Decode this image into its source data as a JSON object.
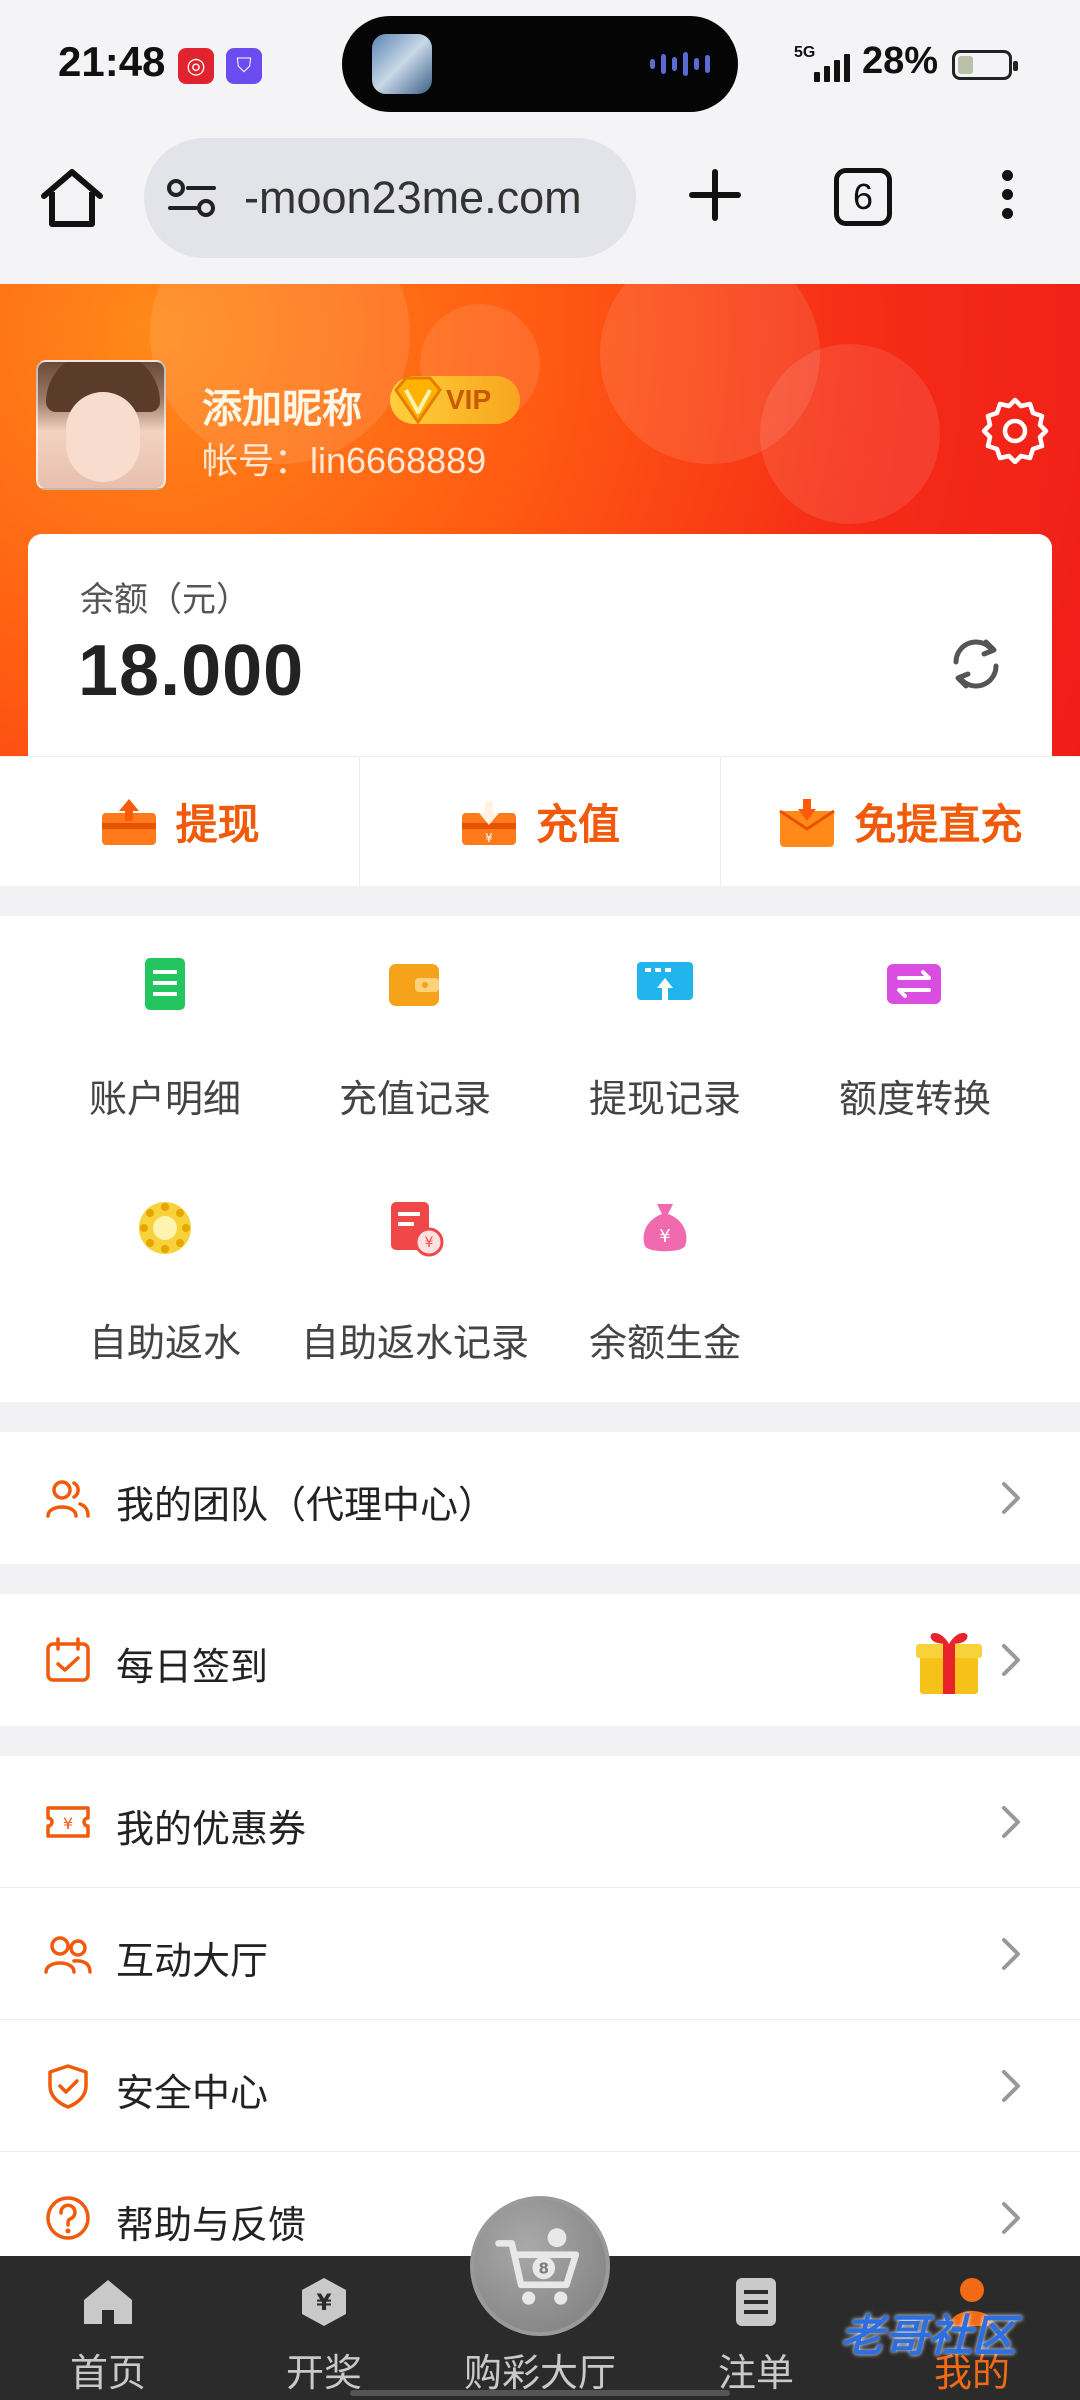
{
  "status_bar": {
    "time": "21:48",
    "network": "5G",
    "battery": "28%"
  },
  "browser": {
    "url": "-moon23me.com",
    "tab_count": "6"
  },
  "profile": {
    "nickname": "添加昵称",
    "vip_label": "VIP",
    "account": "帐号：lin6668889"
  },
  "balance": {
    "label": "余额（元）",
    "value": "18.000"
  },
  "actions": [
    {
      "label": "提现"
    },
    {
      "label": "充值"
    },
    {
      "label": "免提直充"
    }
  ],
  "grid": [
    {
      "label": "账户明细",
      "icon": "ledger-icon",
      "color": "#22c55e"
    },
    {
      "label": "充值记录",
      "icon": "wallet-icon",
      "color": "#f59e0b"
    },
    {
      "label": "提现记录",
      "icon": "withdraw-card-icon",
      "color": "#22a7e8"
    },
    {
      "label": "额度转换",
      "icon": "transfer-icon",
      "color": "#d946ef"
    },
    {
      "label": "自助返水",
      "icon": "coin-icon",
      "color": "#f5c518"
    },
    {
      "label": "自助返水记录",
      "icon": "rebate-record-icon",
      "color": "#ef4444"
    },
    {
      "label": "余额生金",
      "icon": "money-bag-icon",
      "color": "#ec4899"
    }
  ],
  "menu": {
    "team": "我的团队（代理中心）",
    "checkin": "每日签到",
    "coupons": "我的优惠券",
    "lobby": "互动大厅",
    "security": "安全中心",
    "help": "帮助与反馈"
  },
  "nav": [
    {
      "label": "首页"
    },
    {
      "label": "开奖"
    },
    {
      "label": "购彩大厅"
    },
    {
      "label": "注单"
    },
    {
      "label": "我的"
    }
  ],
  "watermark": "老哥社区",
  "colors": {
    "accent": "#f05a0a",
    "hero_start": "#ff8a1a",
    "hero_end": "#ef1d1a",
    "nav_bg": "#2b2b2b"
  }
}
